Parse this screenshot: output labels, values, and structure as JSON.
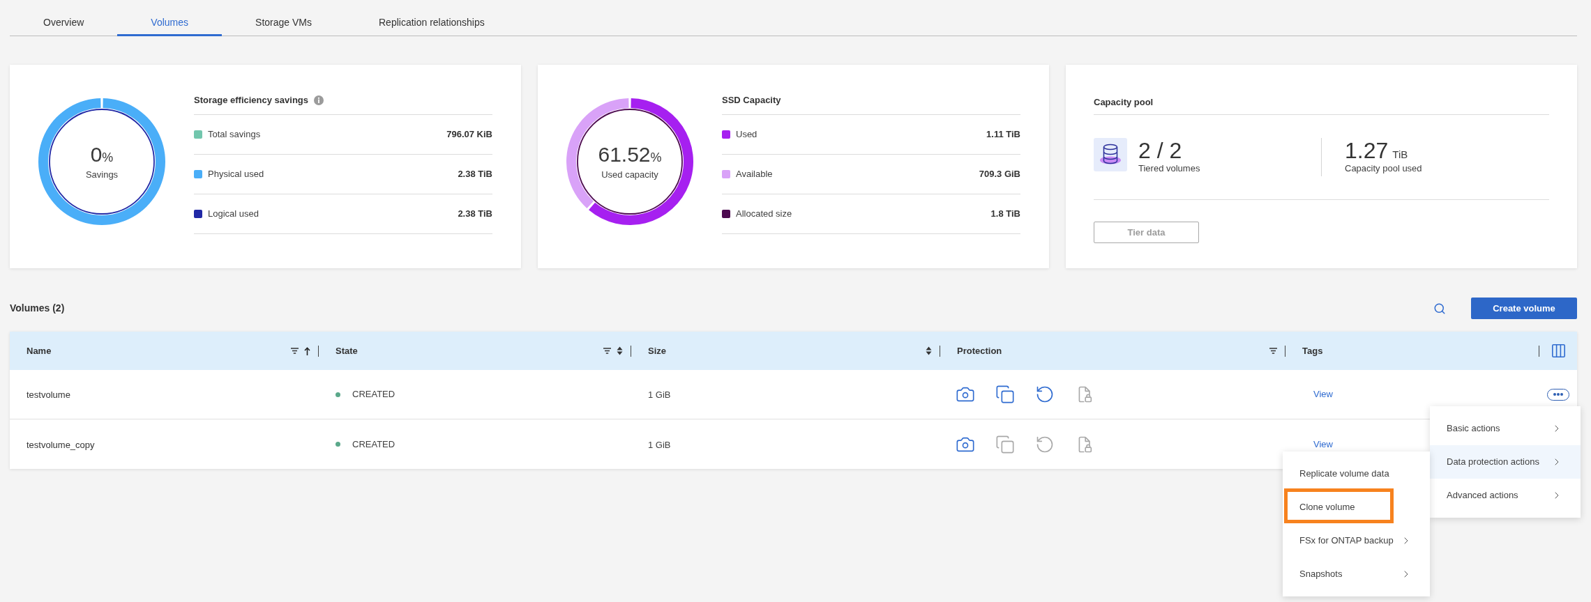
{
  "tabs": [
    {
      "label": "Overview",
      "selected": false
    },
    {
      "label": "Volumes",
      "selected": true
    },
    {
      "label": "Storage VMs",
      "selected": false
    },
    {
      "label": "Replication relationships",
      "selected": false
    }
  ],
  "cards": [
    {
      "kind": "donut",
      "title": "Storage efficiency savings",
      "info_icon": true,
      "gauge": {
        "value": "0",
        "unit": "%",
        "caption": "Savings"
      },
      "legend": [
        {
          "label": "Total savings",
          "value": "796.07 KiB",
          "color": "#72c6ad"
        },
        {
          "label": "Physical used",
          "value": "2.38 TiB",
          "color": "#4aaef8"
        },
        {
          "label": "Logical used",
          "value": "2.38 TiB",
          "color": "#2129a6"
        }
      ]
    },
    {
      "kind": "donut",
      "title": "SSD Capacity",
      "gauge": {
        "value": "61.52",
        "unit": "%",
        "caption": "Used capacity"
      },
      "chart_data": {
        "type": "donut",
        "values": [
          61.52,
          38.48
        ]
      },
      "legend": [
        {
          "label": "Used",
          "value": "1.11 TiB",
          "color": "#a620f0"
        },
        {
          "label": "Available",
          "value": "709.3 GiB",
          "color": "#d9a2f8"
        },
        {
          "label": "Allocated size",
          "value": "1.8 TiB",
          "color": "#4d0a50"
        }
      ]
    },
    {
      "kind": "pool",
      "title": "Capacity pool",
      "stats": [
        {
          "kind": "icon",
          "value": "2 / 2",
          "caption": "Tiered volumes"
        },
        {
          "kind": "plain",
          "value": "1.27",
          "unit": "TiB",
          "caption": "Capacity pool used"
        }
      ],
      "button": {
        "label": "Tier data",
        "disabled": true
      }
    }
  ],
  "volumes": {
    "title": "Volumes (2)",
    "create_button": "Create volume",
    "columns": [
      {
        "label": "Name",
        "filter": true,
        "sortable": true,
        "sorted_ascending": true
      },
      {
        "label": "State",
        "filter": true,
        "sortable": true,
        "sorted_ascending": false
      },
      {
        "label": "Size",
        "filter": false,
        "sortable": true,
        "sorted_ascending": false
      },
      {
        "label": "Protection",
        "filter": true,
        "sortable": false
      },
      {
        "label": "Tags",
        "filter": false,
        "sortable": false
      }
    ],
    "rows": [
      {
        "name": "testvolume",
        "state": {
          "label": "CREATED",
          "color": "#5aa88a"
        },
        "size": "1 GiB",
        "protection": [
          {
            "kind": "camera",
            "enabled": true
          },
          {
            "kind": "copy",
            "enabled": true
          },
          {
            "kind": "undo",
            "enabled": true
          },
          {
            "kind": "lockfile",
            "enabled": false
          }
        ],
        "tags": "View",
        "actions_button": true
      },
      {
        "name": "testvolume_copy",
        "state": {
          "label": "CREATED",
          "color": "#5aa88a"
        },
        "size": "1 GiB",
        "protection": [
          {
            "kind": "camera",
            "enabled": true
          },
          {
            "kind": "copy",
            "enabled": false
          },
          {
            "kind": "undo",
            "enabled": false
          },
          {
            "kind": "lockfile",
            "enabled": false
          }
        ],
        "tags": "View"
      }
    ]
  },
  "row_menu": {
    "items": [
      {
        "label": "Basic actions",
        "submenu": true,
        "selected": false
      },
      {
        "label": "Data protection actions",
        "submenu": true,
        "selected": true
      },
      {
        "label": "Advanced actions",
        "submenu": true,
        "selected": false
      }
    ]
  },
  "submenu": {
    "items": [
      {
        "label": "Replicate volume data",
        "submenu": false,
        "highlighted": false
      },
      {
        "label": "Clone volume",
        "submenu": false,
        "highlighted": true
      },
      {
        "label": "FSx for ONTAP backup",
        "submenu": true,
        "highlighted": false
      },
      {
        "label": "Snapshots",
        "submenu": true,
        "highlighted": false
      }
    ]
  }
}
